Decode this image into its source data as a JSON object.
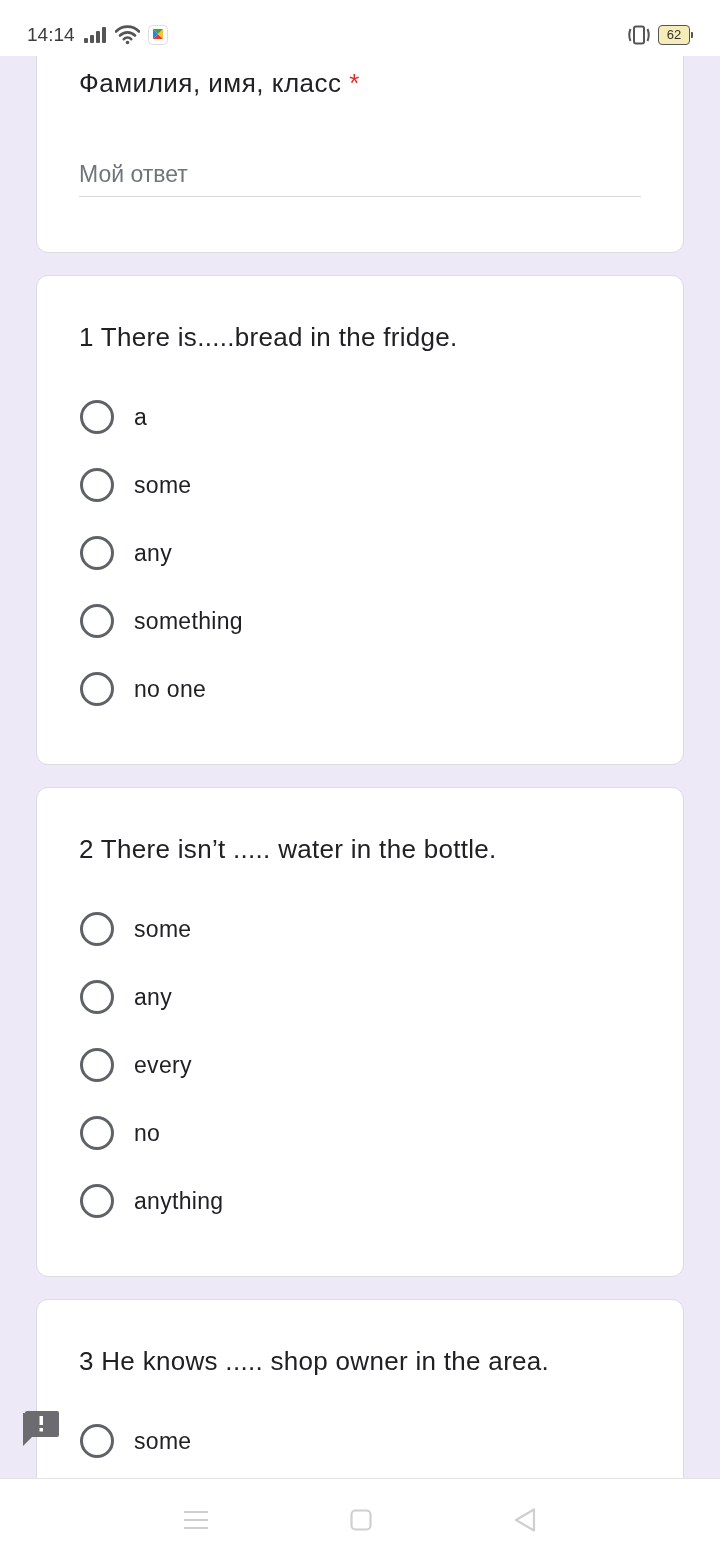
{
  "status_bar": {
    "time": "14:14",
    "battery": "62"
  },
  "form": {
    "name_question": {
      "title": "Фамилия, имя, класс",
      "required_mark": "*",
      "placeholder": "Мой ответ"
    },
    "questions": [
      {
        "title": "1 There is.....bread in the fridge.",
        "options": [
          {
            "label": "a",
            "selected": false
          },
          {
            "label": "some",
            "selected": false
          },
          {
            "label": "any",
            "selected": false
          },
          {
            "label": "something",
            "selected": false
          },
          {
            "label": "no one",
            "selected": false
          }
        ]
      },
      {
        "title": "2 There isn’t ..... water in the bottle.",
        "options": [
          {
            "label": "some",
            "selected": false
          },
          {
            "label": "any",
            "selected": false
          },
          {
            "label": "every",
            "selected": false
          },
          {
            "label": "no",
            "selected": false
          },
          {
            "label": "anything",
            "selected": false
          }
        ]
      },
      {
        "title": "3 He knows ..... shop owner in the area.",
        "options": [
          {
            "label": "some",
            "selected": false
          }
        ]
      }
    ]
  }
}
